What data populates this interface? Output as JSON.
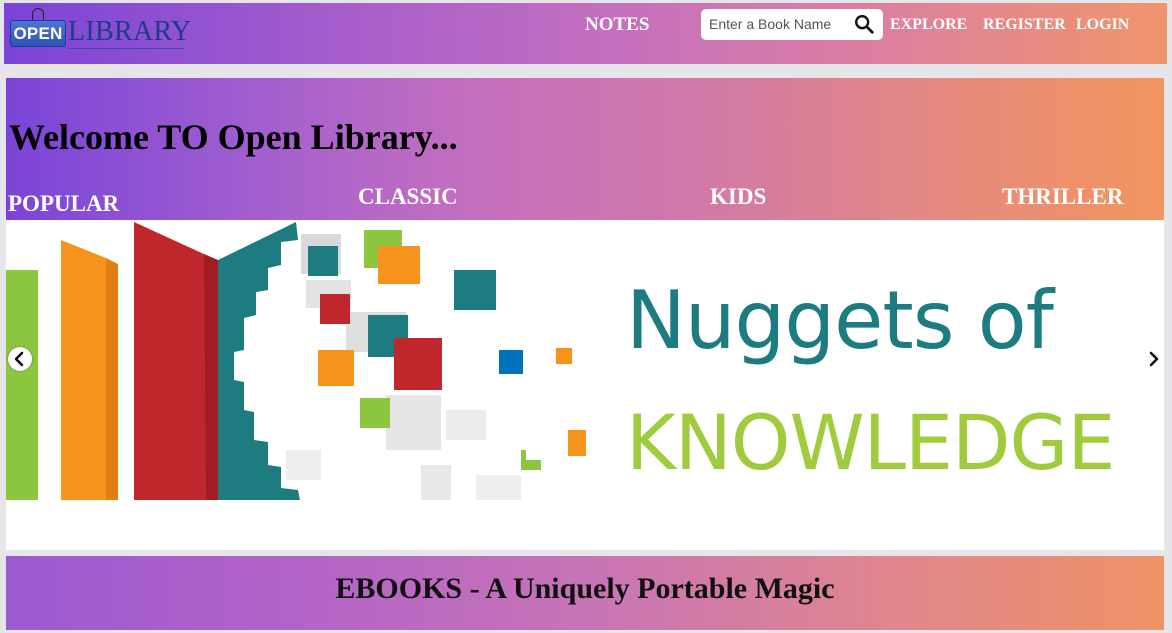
{
  "navbar": {
    "logo_badge": "OPEN",
    "logo_text": "LIBRARY",
    "links": {
      "notes": "NOTES",
      "explore": "EXPLORE",
      "register": "REGISTER",
      "login": "LOGIN"
    },
    "search": {
      "placeholder": "Enter a Book Name",
      "value": ""
    }
  },
  "hero": {
    "welcome": "Welcome TO Open Library...",
    "categories": [
      "POPULAR",
      "CLASSIC",
      "KIDS",
      "THRILLER"
    ]
  },
  "carousel": {
    "slide_line1": "Nuggets of",
    "slide_line2": "KNOWLEDGE",
    "prev_icon": "chevron-left-icon",
    "next_icon": "chevron-right-icon"
  },
  "banner": {
    "title": "EBOOKS - A Uniquely Portable Magic"
  },
  "colors": {
    "gradient_start": "#7a44d8",
    "gradient_mid": "#c46fbf",
    "gradient_end": "#f2955e",
    "teal": "#1c7c7f",
    "lime": "#9fcb3c",
    "red": "#c0272d",
    "orange": "#f7941d"
  }
}
